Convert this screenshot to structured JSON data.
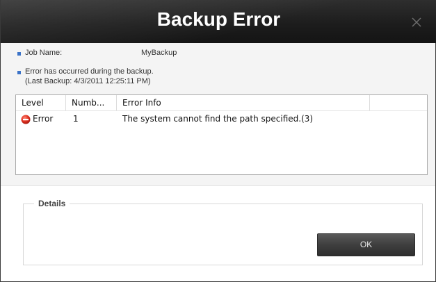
{
  "dialog": {
    "title": "Backup Error"
  },
  "info": {
    "job_name_label": "Job Name:",
    "job_name_value": "MyBackup",
    "error_message": "Error has occurred during the backup.",
    "last_backup": "(Last Backup: 4/3/2011 12:25:11 PM)"
  },
  "table": {
    "columns": [
      "Level",
      "Numb...",
      "Error Info"
    ],
    "rows": [
      {
        "level": "Error",
        "number": "1",
        "info": "The system cannot find the path specified.(3)"
      }
    ]
  },
  "details": {
    "legend": "Details",
    "ok_label": "OK"
  },
  "icons": {
    "close": "close-icon",
    "bullet": "bullet-icon",
    "error": "error-icon"
  },
  "colors": {
    "titlebar": "#1d1d1d",
    "bullet": "#3b73c8",
    "error_icon": "#d8261a"
  }
}
